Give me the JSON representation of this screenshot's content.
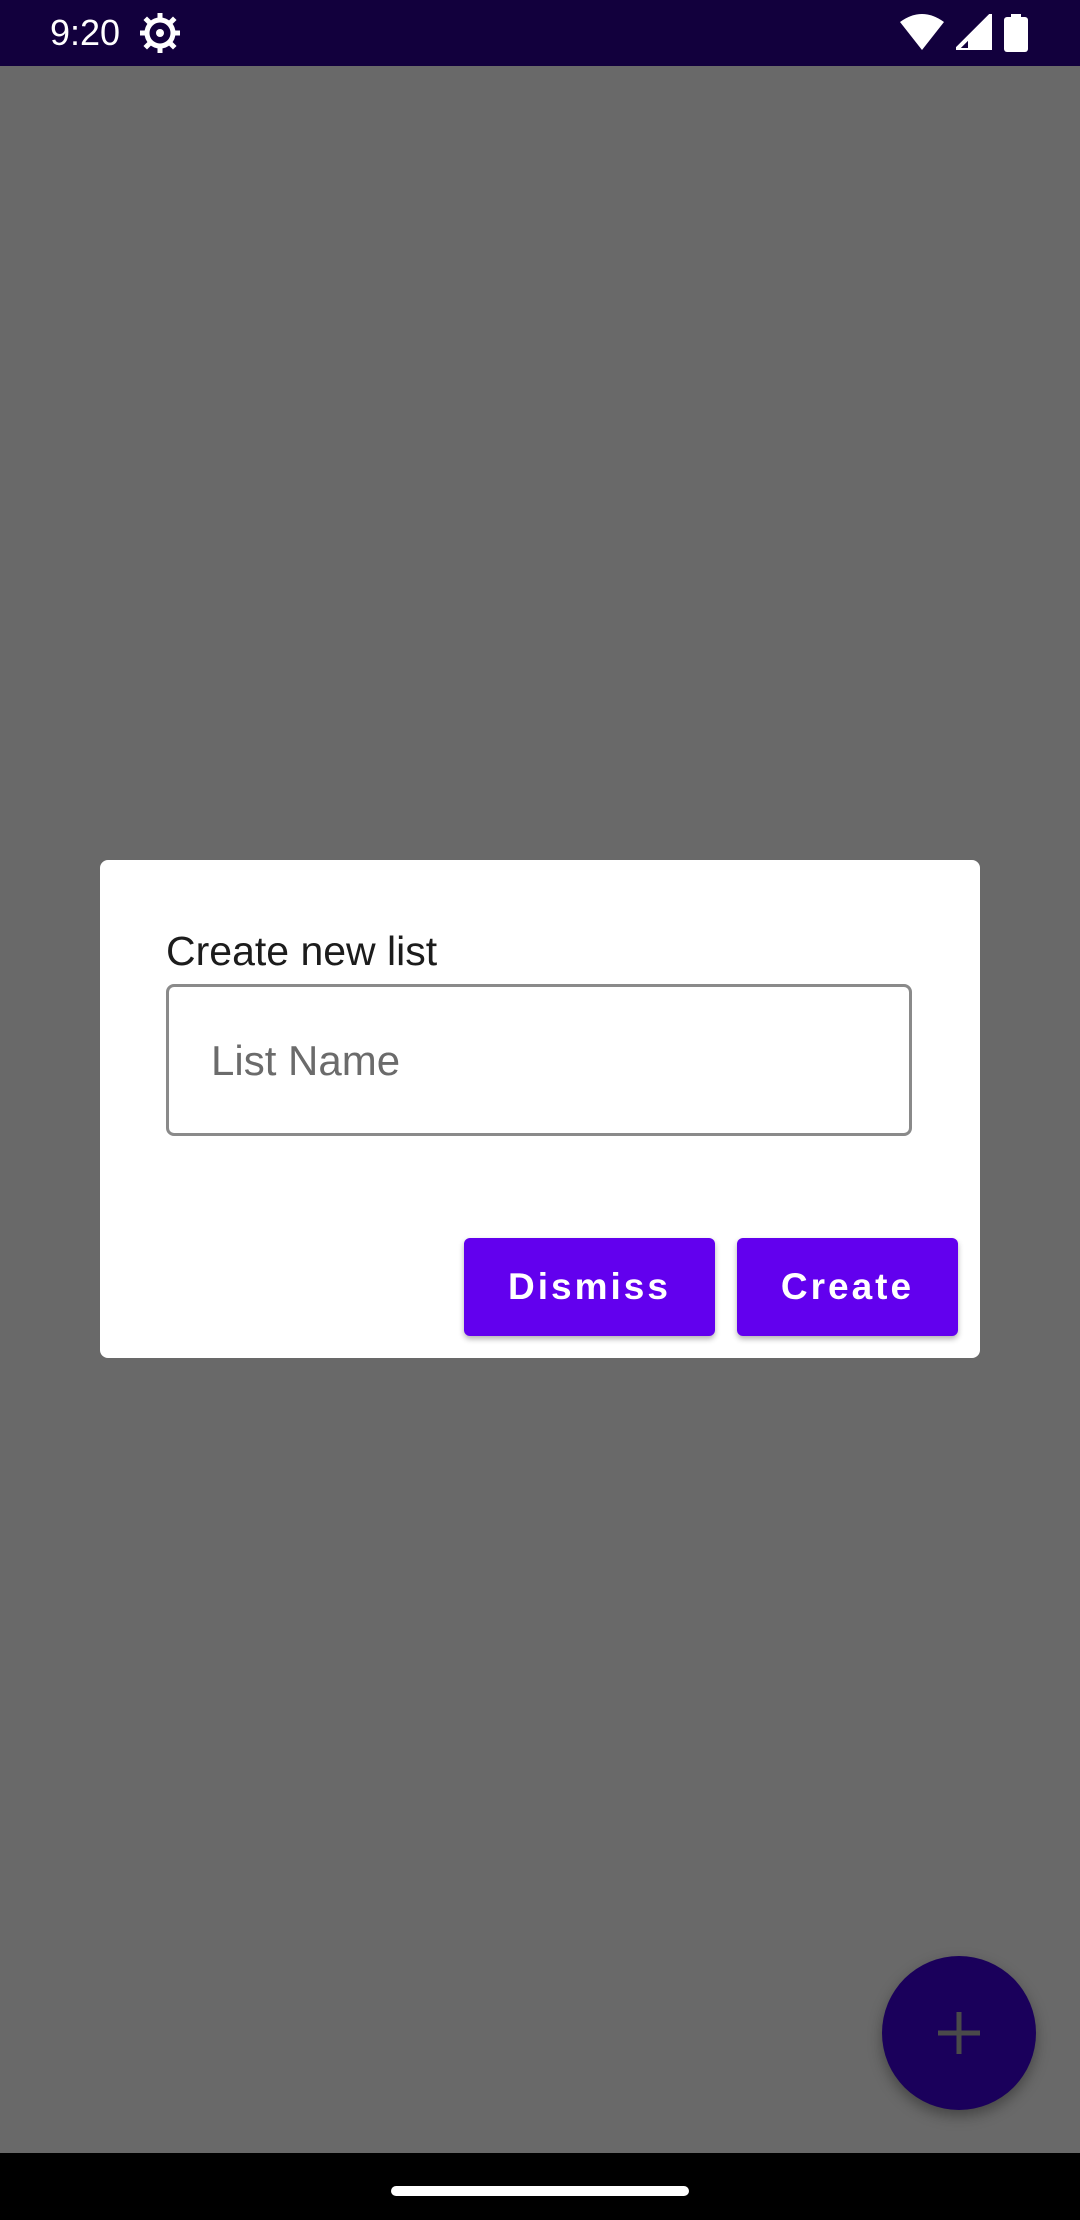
{
  "status_bar": {
    "time": "9:20",
    "icons": [
      "settings-icon",
      "wifi-icon",
      "signal-icon",
      "battery-icon"
    ]
  },
  "dialog": {
    "title": "Create new list",
    "input": {
      "placeholder": "List Name",
      "value": ""
    },
    "buttons": {
      "dismiss_label": "Dismiss",
      "create_label": "Create"
    }
  },
  "fab": {
    "icon": "plus-icon"
  },
  "colors": {
    "status_bar": "#12003d",
    "scrim_background": "#696969",
    "accent": "#6200ee",
    "fab": "#1a005b",
    "dialog_background": "#ffffff"
  }
}
